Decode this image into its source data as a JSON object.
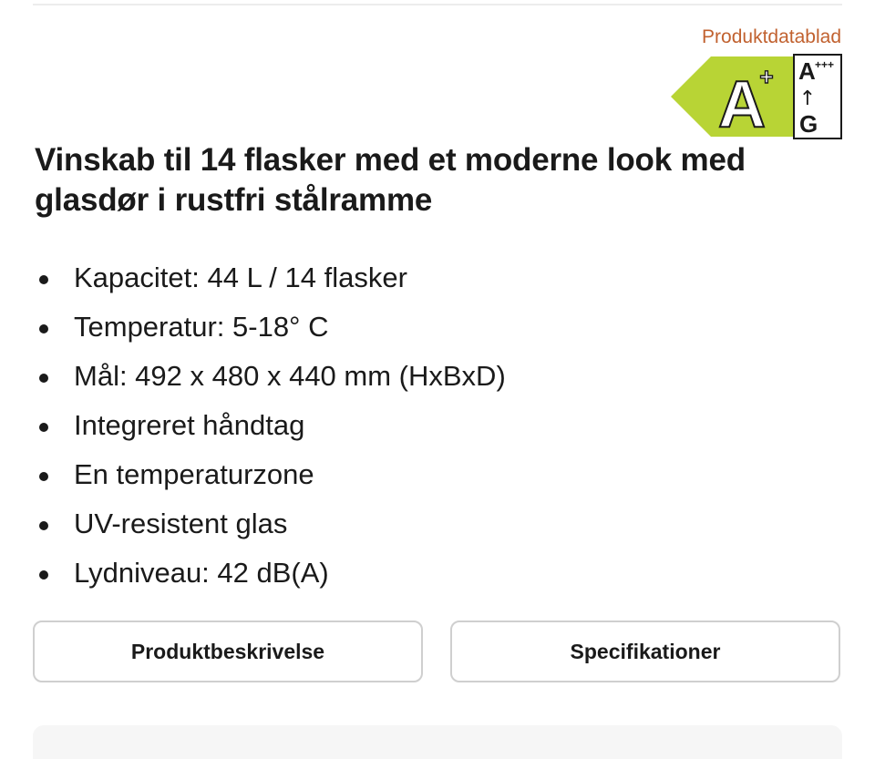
{
  "header": {
    "datasheet_link": "Produktdatablad"
  },
  "energy_label": {
    "rating": "A",
    "rating_suffix": "+",
    "scale_top": "A",
    "scale_top_suffix": "+++",
    "scale_arrow": "↑",
    "scale_bottom": "G",
    "colors": {
      "arrow_fill": "#b8d435",
      "border": "#1a1a1a"
    }
  },
  "product": {
    "title": "Vinskab til 14 flasker med et moderne look med glasdør i rustfri stålramme",
    "features": [
      "Kapacitet: 44 L / 14 flasker",
      "Temperatur: 5-18° C",
      "Mål: 492 x 480 x 440 mm (HxBxD)",
      "Integreret håndtag",
      "En temperaturzone",
      "UV-resistent glas",
      "Lydniveau: 42 dB(A)"
    ]
  },
  "tabs": {
    "description_label": "Produktbeskrivelse",
    "specifications_label": "Specifikationer"
  },
  "colors": {
    "link": "#c1612f",
    "text": "#1a1a1a",
    "button_border": "#cfcfcf",
    "panel_bg": "#f6f6f6"
  }
}
